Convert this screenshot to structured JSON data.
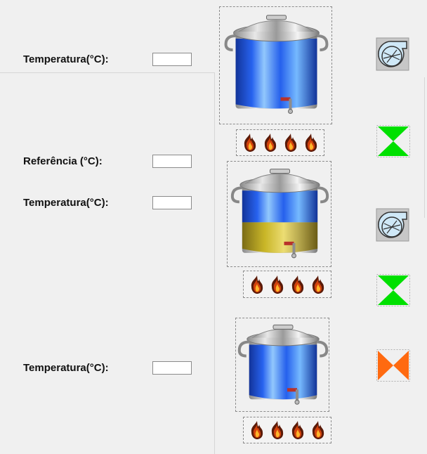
{
  "labels": {
    "temp1": "Temperatura(°C):",
    "ref": "Referência (°C):",
    "temp2": "Temperatura(°C):",
    "temp3": "Temperatura(°C):"
  },
  "fields": {
    "temp1": "",
    "ref": "",
    "temp2": "",
    "temp3": ""
  },
  "colors": {
    "water": "#1e5cf0",
    "wort": "#c8b41e",
    "valve_open": "#00e000",
    "valve_closed": "#ff6a10",
    "pump_fill": "#cfe8f7"
  },
  "icons": {
    "pot": "stainless-steel-pot-icon",
    "flame": "flame-icon",
    "pump": "pump-icon",
    "valve": "valve-icon"
  }
}
